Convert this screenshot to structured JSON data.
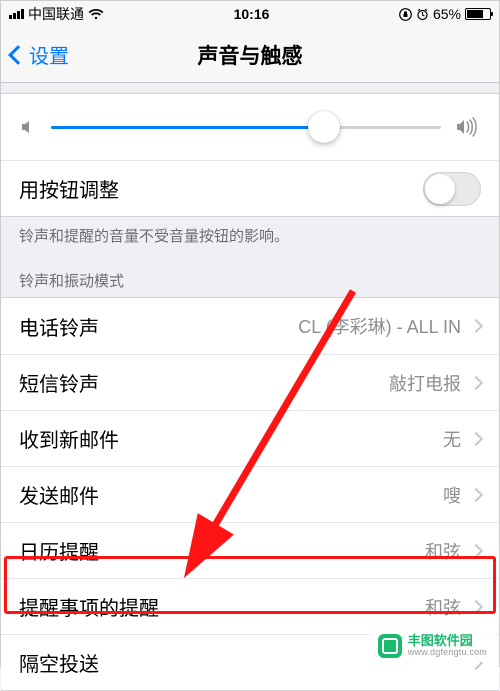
{
  "status": {
    "carrier": "中国联通",
    "time": "10:16",
    "battery_pct": "65%"
  },
  "nav": {
    "back_label": "设置",
    "title": "声音与触感"
  },
  "slider": {
    "value_pct": 70
  },
  "toggle_row": {
    "label": "用按钮调整",
    "value": false
  },
  "footer_text": "铃声和提醒的音量不受音量按钮的影响。",
  "section_header": "铃声和振动模式",
  "rows": [
    {
      "label": "电话铃声",
      "value": "CL (李彩琳) - ALL IN"
    },
    {
      "label": "短信铃声",
      "value": "敲打电报"
    },
    {
      "label": "收到新邮件",
      "value": "无"
    },
    {
      "label": "发送邮件",
      "value": "嗖"
    },
    {
      "label": "日历提醒",
      "value": "和弦"
    },
    {
      "label": "提醒事项的提醒",
      "value": "和弦"
    },
    {
      "label": "隔空投送",
      "value": ""
    }
  ],
  "watermark": {
    "name": "丰图软件园",
    "url": "www.dgfengtu.com"
  }
}
